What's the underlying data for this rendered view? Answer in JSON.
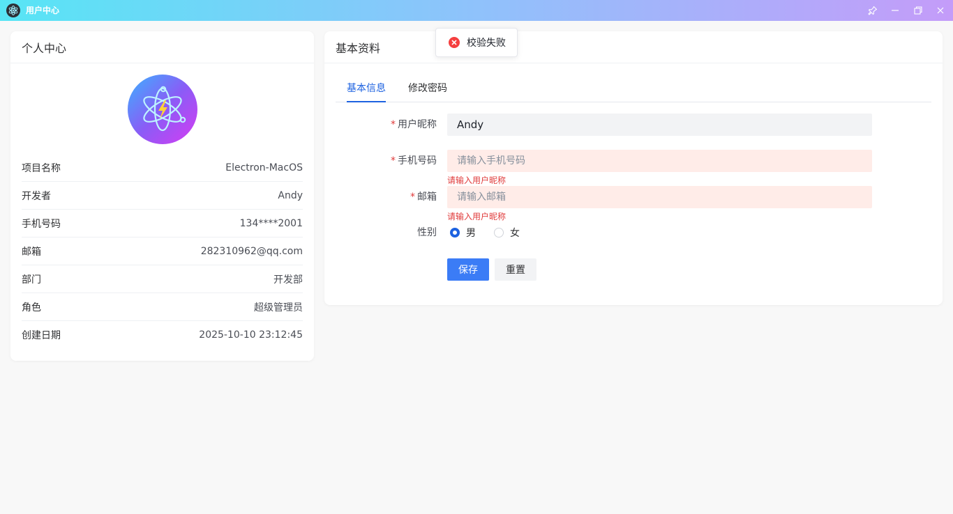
{
  "window": {
    "title": "用户中心",
    "logo_icon": "electron-logo-icon",
    "controls": [
      "pin-icon",
      "minimize-icon",
      "restore-icon",
      "close-icon"
    ]
  },
  "profile": {
    "header": "个人中心",
    "avatar_icon": "electron-atom-icon",
    "rows": [
      {
        "label": "项目名称",
        "value": "Electron-MacOS"
      },
      {
        "label": "开发者",
        "value": "Andy"
      },
      {
        "label": "手机号码",
        "value": "134****2001"
      },
      {
        "label": "邮箱",
        "value": "282310962@qq.com"
      },
      {
        "label": "部门",
        "value": "开发部"
      },
      {
        "label": "角色",
        "value": "超级管理员"
      },
      {
        "label": "创建日期",
        "value": "2025-10-10 23:12:45"
      }
    ]
  },
  "basic": {
    "header": "基本资料",
    "tabs": [
      {
        "label": "基本信息",
        "active": true
      },
      {
        "label": "修改密码",
        "active": false
      }
    ],
    "form": {
      "nickname": {
        "label": "用户昵称",
        "value": "Andy",
        "required": "*"
      },
      "phone": {
        "label": "手机号码",
        "value": "",
        "placeholder": "请输入手机号码",
        "required": "*",
        "error": "请输入用户昵称"
      },
      "email": {
        "label": "邮箱",
        "value": "",
        "placeholder": "请输入邮箱",
        "required": "*",
        "error": "请输入用户昵称"
      },
      "gender": {
        "label": "性别",
        "options": [
          "男",
          "女"
        ],
        "selected": "男"
      }
    },
    "buttons": {
      "save": "保存",
      "reset": "重置"
    }
  },
  "toast": {
    "icon": "error-icon",
    "message": "校验失败"
  },
  "colors": {
    "primary": "#3b7cf6",
    "active_tab": "#1d62e0",
    "error": "#f53f3f",
    "error_bg": "#ffece8"
  }
}
